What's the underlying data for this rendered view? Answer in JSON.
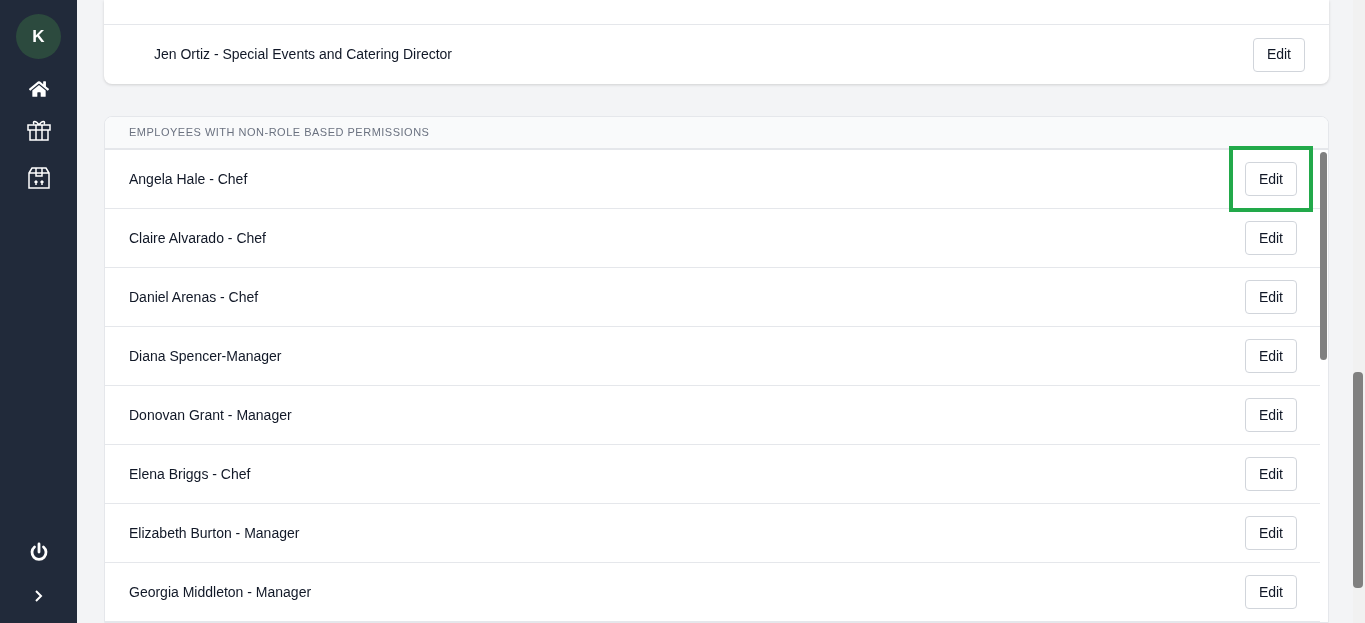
{
  "sidebar": {
    "avatar": "K"
  },
  "role_card": {
    "rows": [
      {
        "label": "Jen Ortiz - Special Events and Catering Director",
        "button": "Edit"
      }
    ]
  },
  "permissions_card": {
    "heading": "EMPLOYEES WITH NON-ROLE BASED PERMISSIONS",
    "rows": [
      {
        "label": "Angela Hale - Chef",
        "button": "Edit",
        "highlighted": true
      },
      {
        "label": "Claire Alvarado - Chef",
        "button": "Edit",
        "highlighted": false
      },
      {
        "label": "Daniel Arenas - Chef",
        "button": "Edit",
        "highlighted": false
      },
      {
        "label": "Diana Spencer-Manager",
        "button": "Edit",
        "highlighted": false
      },
      {
        "label": "Donovan Grant - Manager",
        "button": "Edit",
        "highlighted": false
      },
      {
        "label": "Elena Briggs - Chef",
        "button": "Edit",
        "highlighted": false
      },
      {
        "label": "Elizabeth Burton - Manager",
        "button": "Edit",
        "highlighted": false
      },
      {
        "label": "Georgia Middleton - Manager",
        "button": "Edit",
        "highlighted": false
      }
    ]
  }
}
